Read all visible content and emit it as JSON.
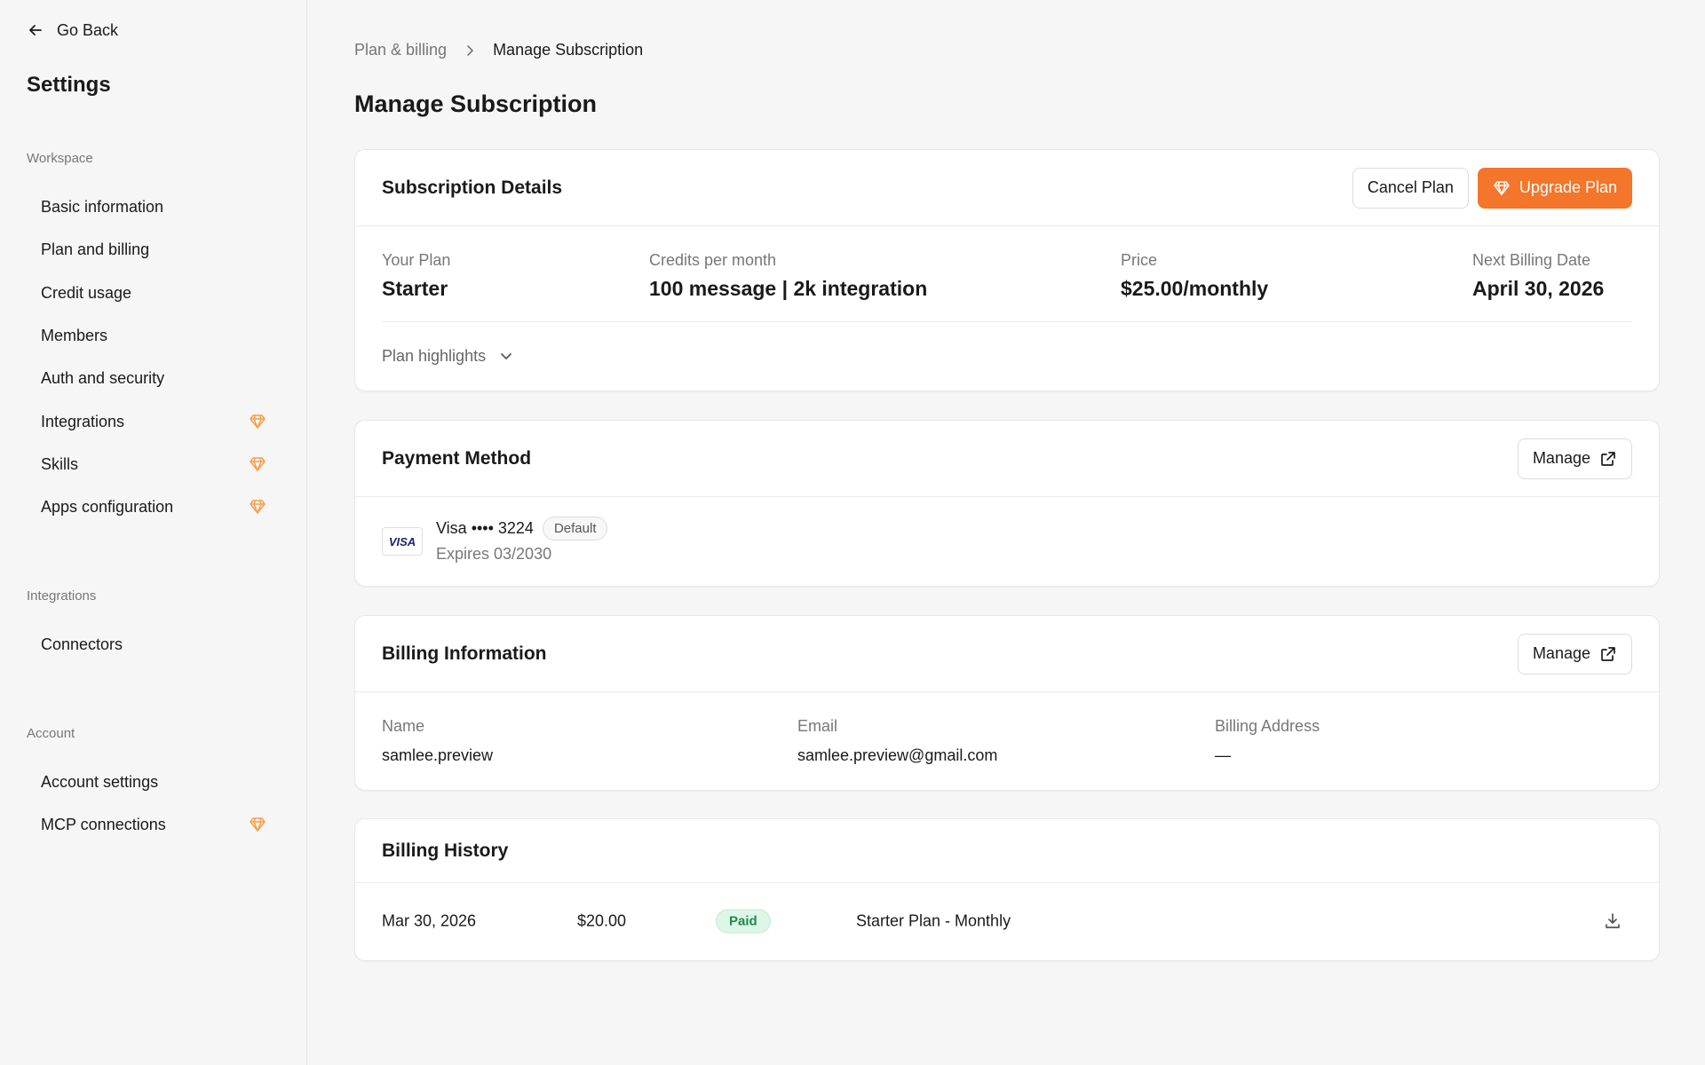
{
  "sidebar": {
    "go_back": "Go Back",
    "title": "Settings",
    "sections": [
      {
        "label": "Workspace",
        "items": [
          {
            "label": "Basic information",
            "premium": false
          },
          {
            "label": "Plan and billing",
            "premium": false
          },
          {
            "label": "Credit usage",
            "premium": false
          },
          {
            "label": "Members",
            "premium": false
          },
          {
            "label": "Auth and security",
            "premium": false
          },
          {
            "label": "Integrations",
            "premium": true
          },
          {
            "label": "Skills",
            "premium": true
          },
          {
            "label": "Apps configuration",
            "premium": true
          }
        ]
      },
      {
        "label": "Integrations",
        "items": [
          {
            "label": "Connectors",
            "premium": false
          }
        ]
      },
      {
        "label": "Account",
        "items": [
          {
            "label": "Account settings",
            "premium": false
          },
          {
            "label": "MCP connections",
            "premium": true
          }
        ]
      }
    ]
  },
  "breadcrumb": {
    "parent": "Plan & billing",
    "current": "Manage Subscription"
  },
  "page_title": "Manage Subscription",
  "subscription": {
    "title": "Subscription Details",
    "cancel_label": "Cancel Plan",
    "upgrade_label": "Upgrade Plan",
    "your_plan_label": "Your Plan",
    "your_plan_value": "Starter",
    "credits_label": "Credits per month",
    "credits_value": "100 message | 2k integration",
    "price_label": "Price",
    "price_value": "$25.00/monthly",
    "next_billing_label": "Next Billing Date",
    "next_billing_value": "April 30, 2026",
    "highlights_label": "Plan highlights"
  },
  "payment": {
    "title": "Payment Method",
    "manage_label": "Manage",
    "card_brand_logo": "VISA",
    "card_text": "Visa •••• 3224",
    "default_badge": "Default",
    "expires": "Expires 03/2030"
  },
  "billing_info": {
    "title": "Billing Information",
    "manage_label": "Manage",
    "name_label": "Name",
    "name_value": "samlee.preview",
    "email_label": "Email",
    "email_value": "samlee.preview@gmail.com",
    "address_label": "Billing Address",
    "address_value": "—"
  },
  "billing_history": {
    "title": "Billing History",
    "rows": [
      {
        "date": "Mar 30, 2026",
        "amount": "$20.00",
        "status": "Paid",
        "description": "Starter Plan - Monthly"
      }
    ]
  },
  "colors": {
    "accent": "#f3762a",
    "premium_gem": "#f5a04a",
    "paid_text": "#1e8a4c",
    "paid_bg": "#def6e7"
  },
  "icons": {
    "go_back": "arrow-left-icon",
    "breadcrumb_sep": "chevron-right-icon",
    "premium": "diamond-icon",
    "highlights": "chevron-down-icon",
    "manage": "external-link-icon",
    "download": "download-icon"
  }
}
